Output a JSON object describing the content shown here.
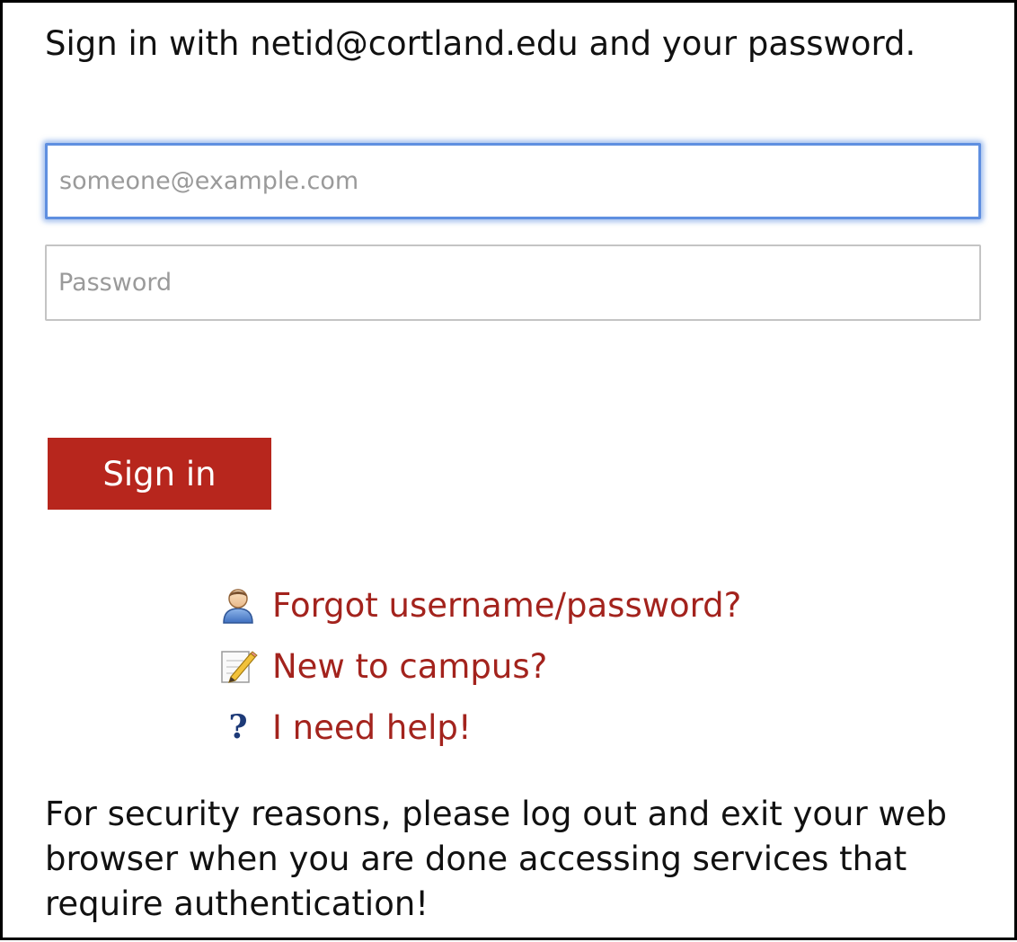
{
  "form": {
    "instruction": "Sign in with netid@cortland.edu and your password.",
    "email_placeholder": "someone@example.com",
    "email_value": "",
    "password_placeholder": "Password",
    "password_value": "",
    "signin_label": "Sign in"
  },
  "links": [
    {
      "label": "Forgot username/password?",
      "icon": "user-icon"
    },
    {
      "label": "New to campus?",
      "icon": "edit-note-icon"
    },
    {
      "label": "I need help!",
      "icon": "help-icon",
      "icon_glyph": "?"
    }
  ],
  "footer": {
    "security_note": "For security reasons, please log out and exit your web browser when you are done accessing services that require authentication!"
  },
  "colors": {
    "brand_red": "#b7261d",
    "link_red": "#a3231d",
    "focus_blue": "#5f8fe0"
  }
}
